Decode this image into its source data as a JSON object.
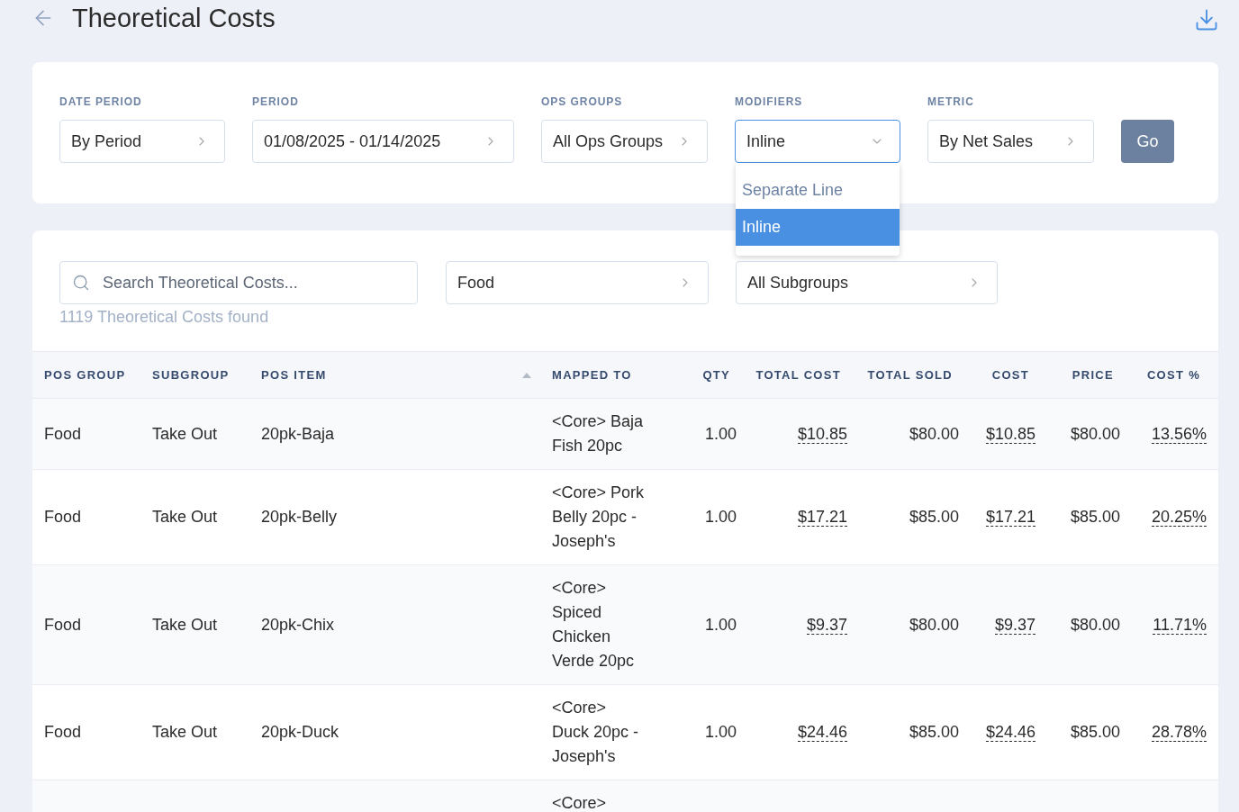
{
  "header": {
    "title": "Theoretical Costs"
  },
  "filters": [
    {
      "label": "DATE PERIOD",
      "value": "By Period",
      "expanded": false
    },
    {
      "label": "PERIOD",
      "value": "01/08/2025 - 01/14/2025",
      "expanded": false
    },
    {
      "label": "OPS GROUPS",
      "value": "All Ops Groups",
      "expanded": false
    },
    {
      "label": "MODIFIERS",
      "value": "Inline",
      "expanded": true,
      "options": [
        {
          "label": "Separate Line",
          "selected": false
        },
        {
          "label": "Inline",
          "selected": true
        }
      ]
    },
    {
      "label": "METRIC",
      "value": "By Net Sales",
      "expanded": false
    }
  ],
  "go_button": "Go",
  "search": {
    "placeholder": "Search Theoretical Costs..."
  },
  "group_filter": {
    "value": "Food"
  },
  "subgroup_filter": {
    "value": "All Subgroups"
  },
  "result_count": "1119 Theoretical Costs found",
  "table": {
    "columns": [
      {
        "label": "POS GROUP",
        "kind": "text",
        "sorted": false
      },
      {
        "label": "SUBGROUP",
        "kind": "text",
        "sorted": false
      },
      {
        "label": "POS ITEM",
        "kind": "text",
        "sorted": true
      },
      {
        "label": "MAPPED TO",
        "kind": "text",
        "sorted": false
      },
      {
        "label": "QTY",
        "kind": "number",
        "sorted": false
      },
      {
        "label": "TOTAL COST",
        "kind": "underlined",
        "sorted": false
      },
      {
        "label": "TOTAL SOLD",
        "kind": "number",
        "sorted": false
      },
      {
        "label": "COST",
        "kind": "underlined",
        "sorted": false
      },
      {
        "label": "PRICE",
        "kind": "number",
        "sorted": false
      },
      {
        "label": "COST %",
        "kind": "underlined",
        "sorted": false
      }
    ],
    "rows": [
      {
        "pos_group": "Food",
        "subgroup": "Take Out",
        "pos_item": "20pk-Baja",
        "mapped_to": "<Core> Baja Fish 20pc",
        "qty": "1.00",
        "total_cost": "$10.85",
        "total_sold": "$80.00",
        "cost": "$10.85",
        "price": "$80.00",
        "cost_pct": "13.56%"
      },
      {
        "pos_group": "Food",
        "subgroup": "Take Out",
        "pos_item": "20pk-Belly",
        "mapped_to": "<Core> Pork Belly 20pc - Joseph's",
        "qty": "1.00",
        "total_cost": "$17.21",
        "total_sold": "$85.00",
        "cost": "$17.21",
        "price": "$85.00",
        "cost_pct": "20.25%"
      },
      {
        "pos_group": "Food",
        "subgroup": "Take Out",
        "pos_item": "20pk-Chix",
        "mapped_to": "<Core> Spiced Chicken Verde 20pc",
        "qty": "1.00",
        "total_cost": "$9.37",
        "total_sold": "$80.00",
        "cost": "$9.37",
        "price": "$80.00",
        "cost_pct": "11.71%"
      },
      {
        "pos_group": "Food",
        "subgroup": "Take Out",
        "pos_item": "20pk-Duck",
        "mapped_to": "<Core> Duck 20pc - Joseph's",
        "qty": "1.00",
        "total_cost": "$24.46",
        "total_sold": "$85.00",
        "cost": "$24.46",
        "price": "$85.00",
        "cost_pct": "28.78%"
      },
      {
        "mapped_to": "<Core>"
      }
    ]
  }
}
